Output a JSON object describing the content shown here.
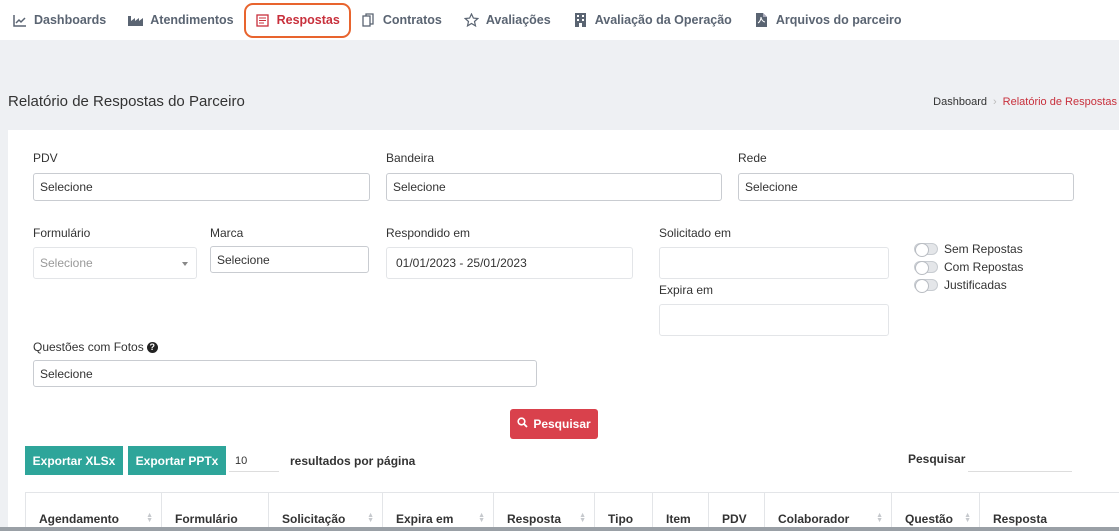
{
  "nav": {
    "items": [
      {
        "label": "Dashboards",
        "icon": "chart-line-icon"
      },
      {
        "label": "Atendimentos",
        "icon": "factory-icon"
      },
      {
        "label": "Respostas",
        "icon": "form-icon",
        "active": true
      },
      {
        "label": "Contratos",
        "icon": "copy-icon"
      },
      {
        "label": "Avaliações",
        "icon": "star-icon"
      },
      {
        "label": "Avaliação da Operação",
        "icon": "building-icon"
      },
      {
        "label": "Arquivos do parceiro",
        "icon": "file-pdf-icon"
      }
    ]
  },
  "page": {
    "title": "Relatório de Respostas do Parceiro",
    "breadcrumb": {
      "home": "Dashboard",
      "current": "Relatório de Respostas"
    }
  },
  "filters": {
    "pdv": {
      "label": "PDV",
      "value": "Selecione"
    },
    "bandeira": {
      "label": "Bandeira",
      "value": "Selecione"
    },
    "rede": {
      "label": "Rede",
      "value": "Selecione"
    },
    "formulario": {
      "label": "Formulário",
      "value": "Selecione"
    },
    "marca": {
      "label": "Marca",
      "value": "Selecione"
    },
    "respondido": {
      "label": "Respondido em",
      "value": "01/01/2023 - 25/01/2023"
    },
    "solicitado": {
      "label": "Solicitado em",
      "value": ""
    },
    "expira": {
      "label": "Expira em",
      "value": ""
    },
    "questoes": {
      "label": "Questões com Fotos",
      "value": "Selecione"
    },
    "toggles": [
      "Sem Repostas",
      "Com Repostas",
      "Justificadas"
    ]
  },
  "actions": {
    "search": "Pesquisar",
    "export_xlsx": "Exportar XLSx",
    "export_pptx": "Exportar PPTx",
    "page_size": "10",
    "per_page": "resultados por página",
    "search_label": "Pesquisar"
  },
  "table": {
    "columns": [
      "Agendamento",
      "Formulário",
      "Solicitação",
      "Expira em",
      "Resposta",
      "Tipo",
      "Item",
      "PDV",
      "Colaborador",
      "Questão",
      "Resposta"
    ]
  },
  "colors": {
    "accent": "#c8303c",
    "highlight": "#e8642e",
    "teal": "#2ea59a",
    "search_button": "#d9414c"
  }
}
